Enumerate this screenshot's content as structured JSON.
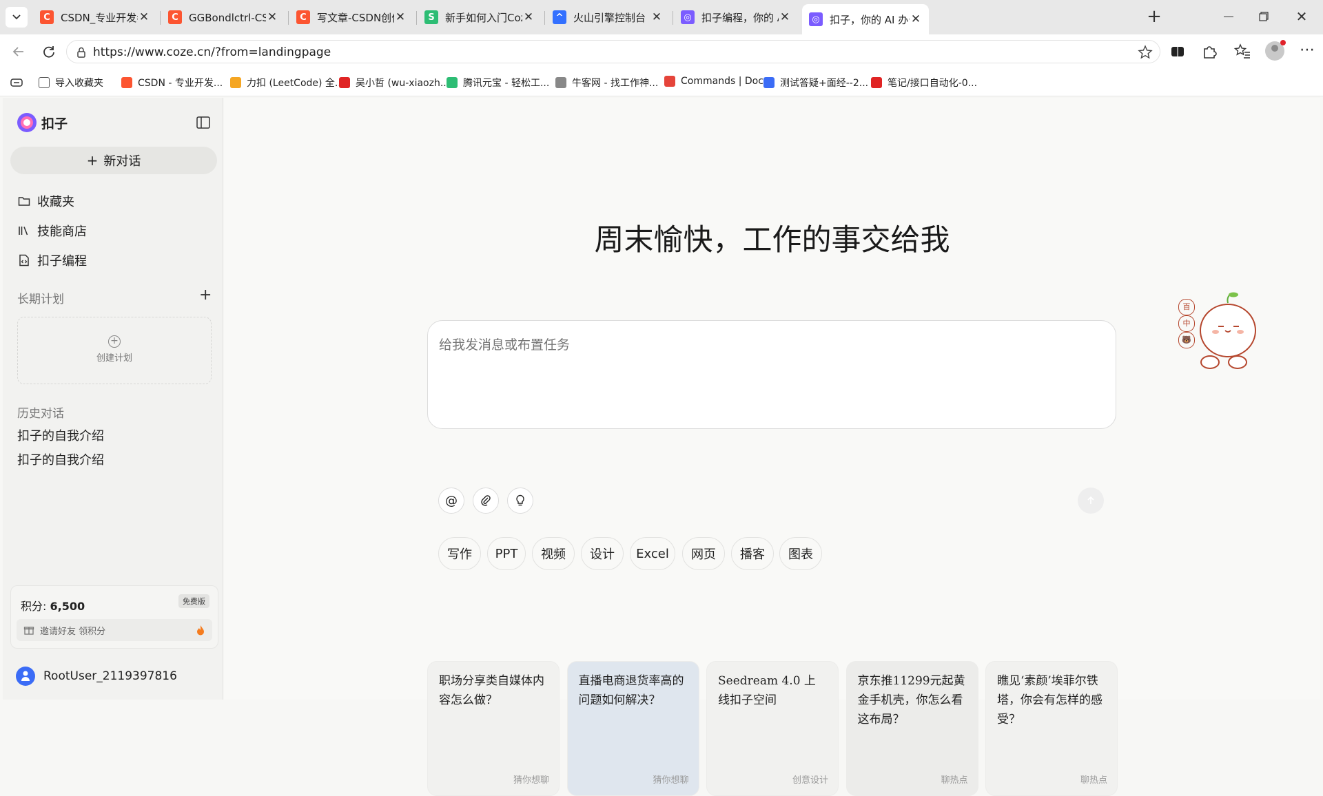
{
  "browser": {
    "tabs": [
      {
        "title": "CSDN_专业开发者社区_",
        "favicon_color": "#fc5531",
        "favicon_letter": "C"
      },
      {
        "title": "GGBondlctrl-CSDN博客",
        "favicon_color": "#fc5531",
        "favicon_letter": "C"
      },
      {
        "title": "写文章-CSDN创作中心",
        "favicon_color": "#fc5531",
        "favicon_letter": "C"
      },
      {
        "title": "新手如何入门Coze工作流",
        "favicon_color": "#2dbd74",
        "favicon_letter": "S"
      },
      {
        "title": "火山引擎控制台",
        "favicon_color": "#3370ff",
        "favicon_letter": "^"
      },
      {
        "title": "扣子编程，你的 AI 开发",
        "favicon_color": "#7b5cff",
        "favicon_letter": "◎"
      },
      {
        "title": "扣子，你的 AI 办公助手",
        "favicon_color": "#7b5cff",
        "favicon_letter": "◎"
      }
    ],
    "url": "https://www.coze.cn/?from=landingpage",
    "bookmarks": [
      {
        "label": "导入收藏夹",
        "color": "#555555"
      },
      {
        "label": "CSDN - 专业开发...",
        "color": "#fc5531"
      },
      {
        "label": "力扣 (LeetCode) 全...",
        "color": "#f5a623"
      },
      {
        "label": "吴小哲 (wu-xiaozh...",
        "color": "#e02424"
      },
      {
        "label": "腾讯元宝 - 轻松工...",
        "color": "#2dbd74"
      },
      {
        "label": "牛客网 - 找工作神...",
        "color": "#888888"
      },
      {
        "label": "Commands | Docs",
        "color": "#e5443a"
      },
      {
        "label": "测试答疑+面经--2...",
        "color": "#3b6cf6"
      },
      {
        "label": "笔记/接口自动化-0...",
        "color": "#e02424"
      }
    ]
  },
  "sidebar": {
    "app_name": "扣子",
    "new_chat": "新对话",
    "nav": [
      "收藏夹",
      "技能商店",
      "扣子编程"
    ],
    "plans_header": "长期计划",
    "create_plan": "创建计划",
    "history_header": "历史对话",
    "history": [
      "扣子的自我介绍",
      "扣子的自我介绍"
    ],
    "points_label": "积分: ",
    "points_value": "6,500",
    "plan_badge": "免费版",
    "invite_text": "邀请好友 领积分",
    "username": "RootUser_2119397816"
  },
  "main": {
    "greeting": "周末愉快，工作的事交给我",
    "input_placeholder": "给我发消息或布置任务",
    "chips": [
      "写作",
      "PPT",
      "视频",
      "设计",
      "Excel",
      "网页",
      "播客",
      "图表"
    ],
    "cards": [
      {
        "title": "职场分享类自媒体内容怎么做？",
        "tag": "猜你想聊",
        "bg": "#f1f1ef"
      },
      {
        "title": "直播电商退货率高的问题如何解决？",
        "tag": "猜你想聊",
        "bg": "#dfe6ee"
      },
      {
        "title": "Seedream 4.0 上线扣子空间",
        "tag": "创意设计",
        "bg": "#f1f1ef"
      },
      {
        "title": "京东推11299元起黄金手机壳，你怎么看这布局？",
        "tag": "聊热点",
        "bg": "#ececea"
      },
      {
        "title": "瞧见‘素颜’埃菲尔铁塔，你会有怎样的感受？",
        "tag": "聊热点",
        "bg": "#f1f1ef"
      }
    ],
    "mascot_badges": [
      "百",
      "中",
      "🐻"
    ]
  },
  "colors": {
    "accent": "#7b5cff",
    "send_disabled": "#eeeeee"
  }
}
